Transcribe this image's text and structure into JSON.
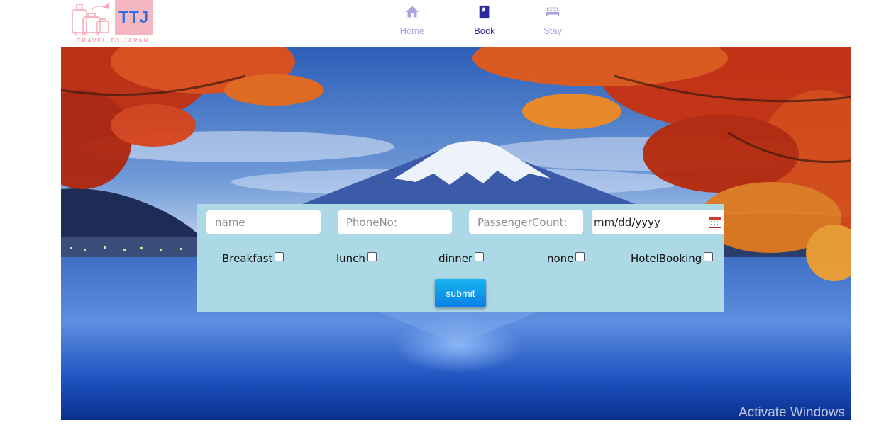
{
  "brand": {
    "logo_text": "TTJ",
    "tagline": "TRAVEL TO JAPAN",
    "colors": {
      "logo_box": "#f4b6c0",
      "logo_text": "#2f6fe6",
      "tagline": "#f4a4b4"
    }
  },
  "nav": {
    "items": [
      {
        "label": "Home",
        "icon": "home-icon",
        "active": false
      },
      {
        "label": "Book",
        "icon": "book-icon",
        "active": true
      },
      {
        "label": "Stay",
        "icon": "bed-icon",
        "active": false
      }
    ],
    "colors": {
      "active": "#2c2a9c",
      "inactive": "#a9a5dc"
    }
  },
  "hero": {
    "image": "mount-fuji-autumn-lake",
    "watermark": "Activate Windows"
  },
  "form": {
    "background": "#add8e6",
    "fields": {
      "name_placeholder": "name",
      "phone_placeholder": "PhoneNo:",
      "passengers_placeholder": "PassengerCount:",
      "date_placeholder": "mm/dd/yyyy"
    },
    "options": [
      {
        "label": "Breakfast",
        "checked": false
      },
      {
        "label": "lunch",
        "checked": false
      },
      {
        "label": "dinner",
        "checked": false
      },
      {
        "label": "none",
        "checked": false
      },
      {
        "label": "HotelBooking",
        "checked": false
      }
    ],
    "submit_label": "submit"
  }
}
